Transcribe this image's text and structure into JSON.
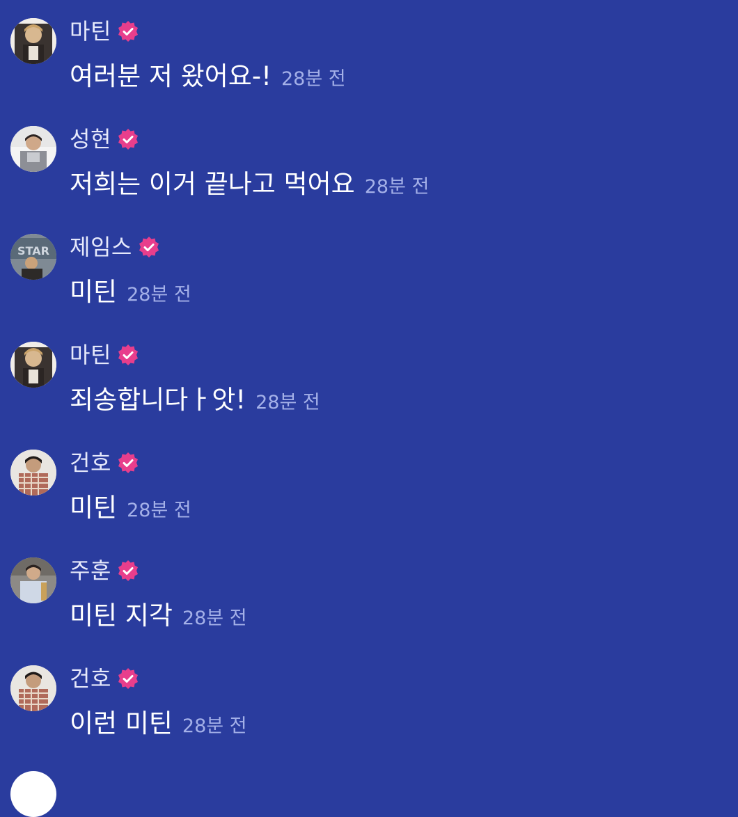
{
  "messages": [
    {
      "avatar": "avatar-photo",
      "username": "마틴",
      "text": "여러분 저 왔어요-!",
      "time": "28분 전",
      "verified_icon": "verified-badge-icon"
    },
    {
      "avatar": "avatar-photo",
      "username": "성현",
      "text": "저희는 이거 끝나고 먹어요",
      "time": "28분 전",
      "verified_icon": "verified-badge-icon"
    },
    {
      "avatar": "avatar-photo",
      "username": "제임스",
      "text": "미틴",
      "time": "28분 전",
      "verified_icon": "verified-badge-icon"
    },
    {
      "avatar": "avatar-photo",
      "username": "마틴",
      "text": "죄송합니다ㅏ앗!",
      "time": "28분 전",
      "verified_icon": "verified-badge-icon"
    },
    {
      "avatar": "avatar-photo",
      "username": "건호",
      "text": "미틴",
      "time": "28분 전",
      "verified_icon": "verified-badge-icon"
    },
    {
      "avatar": "avatar-photo",
      "username": "주훈",
      "text": "미틴 지각",
      "time": "28분 전",
      "verified_icon": "verified-badge-icon"
    },
    {
      "avatar": "avatar-photo",
      "username": "건호",
      "text": "이런 미틴",
      "time": "28분 전",
      "verified_icon": "verified-badge-icon"
    }
  ],
  "colors": {
    "background": "#2a3c9e",
    "verified_badge": "#e83e8c",
    "timestamp": "#a4b0e8"
  }
}
